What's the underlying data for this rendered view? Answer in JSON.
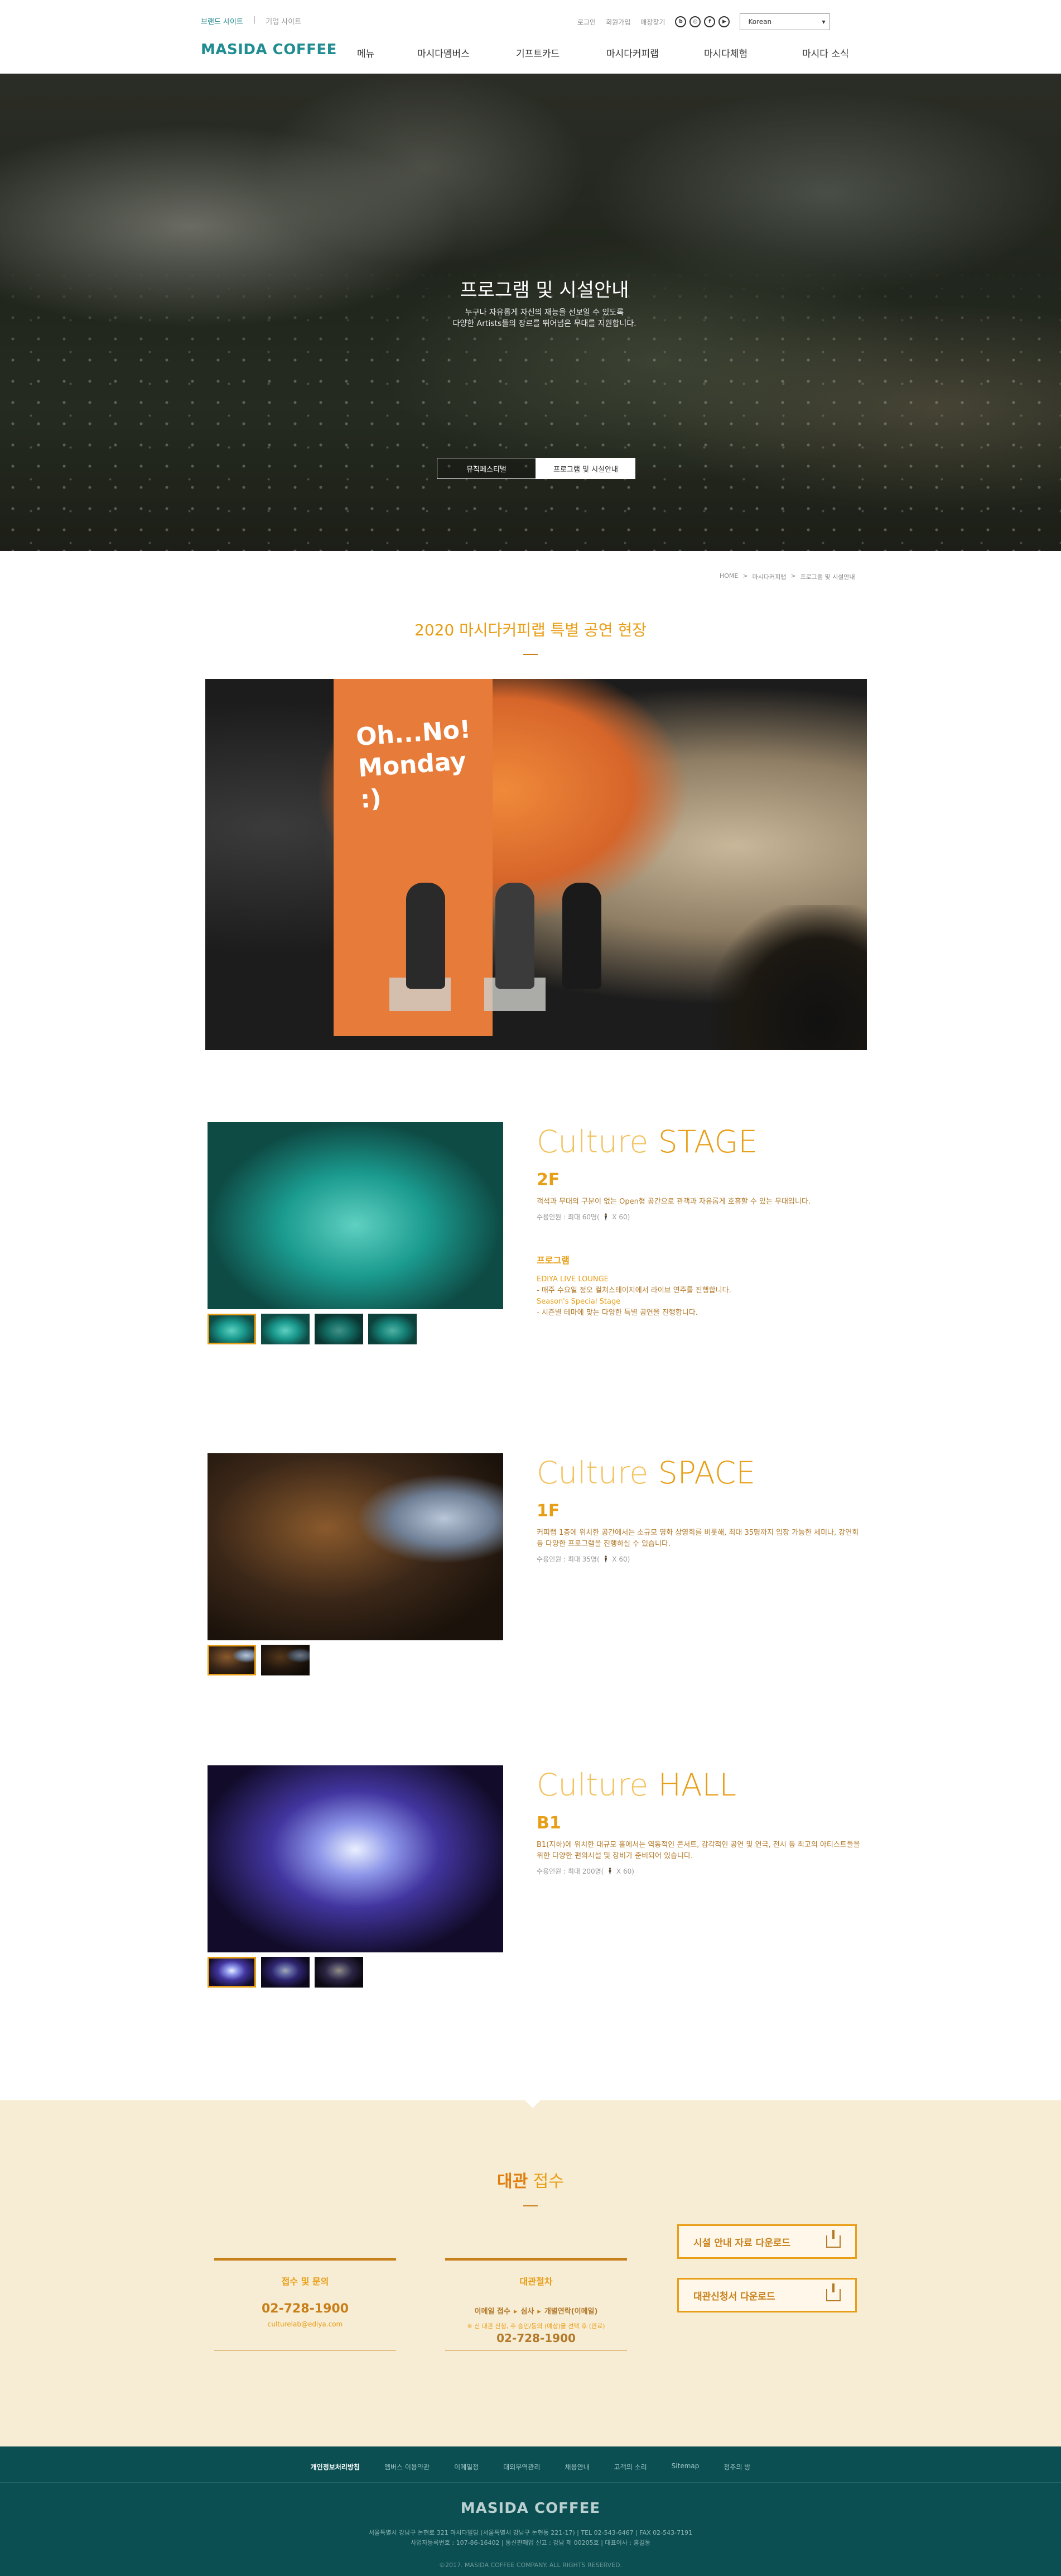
{
  "header": {
    "top_links": [
      "브랜드 사이트",
      "기업 사이트"
    ],
    "util_links": [
      "로그인",
      "회원가입",
      "매장찾기"
    ],
    "sns_icons": [
      "blog-icon",
      "instagram-icon",
      "facebook-icon",
      "youtube-icon"
    ],
    "language": "Korean",
    "logo": "MASIDA COFFEE",
    "menu": [
      "메뉴",
      "마시다멤버스",
      "기프트카드",
      "마시다커피랩",
      "마시다체험",
      "마시다 소식"
    ]
  },
  "hero": {
    "title": "프로그램 및 시설안내",
    "desc_line1": "누구나 자유롭게 자신의 재능을 선보일 수 있도록",
    "desc_line2": "다양한 Artists들의 장르를 뛰어넘은 무대를 지원합니다.",
    "tabs": [
      "뮤직페스티벌",
      "프로그램 및 시설안내"
    ],
    "active_tab": 1
  },
  "breadcrumb": [
    "HOME",
    ">",
    "마시다커피랩",
    ">",
    "프로그램 및 시설안내"
  ],
  "section_title": "2020 마시다커피랩 특별 공연 현장",
  "event_banner_text": "Oh...No!\nMonday\n:)",
  "venues": [
    {
      "culture": "Culture",
      "name": "STAGE",
      "floor": "2F",
      "desc": "객석과 무대의 구분이 없는 Open형 공간으로 관객과 자유롭게 호흡할 수 있는 무대입니다.",
      "capacity": "수용인원 : 최대 60명( 🕴 X 60)",
      "program_heading": "프로그램",
      "programs": [
        {
          "name": "EDIYA LIVE LOUNGE",
          "desc": "- 매주 수요일 정오 컬쳐스테이지에서 라이브 연주를 진행합니다."
        },
        {
          "name": "Season's Special Stage",
          "desc": "- 시즌별 테마에 맞는 다양한 특별 공연을 진행합니다."
        }
      ],
      "thumb_count": 4
    },
    {
      "culture": "Culture",
      "name": "SPACE",
      "floor": "1F",
      "desc": "커피랩 1층에 위치한 공간에서는 소규모 영화 상영회를 비롯해, 최대 35명까지 입장 가능한 세미나, 강연회 등 다양한 프로그램을 진행하실 수 있습니다.",
      "capacity": "수용인원 : 최대 35명( 🕴 X 60)",
      "thumb_count": 2
    },
    {
      "culture": "Culture",
      "name": "HALL",
      "floor": "B1",
      "desc": "B1(지하)에 위치한 대규모 홀에서는 역동적인 콘서트, 감각적인 공연 및 연극, 전시 등 최고의 아티스트들을 위한 다양한 편의시설 및 장비가 준비되어 있습니다.",
      "capacity": "수용인원 : 최대 200명( 🕴 X 60)",
      "thumb_count": 3
    }
  ],
  "rental": {
    "title_bold": "대관",
    "title_rest": " 접수",
    "contact": {
      "heading": "접수 및 문의",
      "phone": "02-728-1900",
      "email": "culturelab@ediya.com"
    },
    "procedure": {
      "heading": "대관절차",
      "steps": [
        "이메일 접수",
        "심사",
        "개별연락(이메일)"
      ],
      "note": "※ 신 대관 신청, 추 승인/등의 (예상)을 선택 후 (만료)",
      "phone": "02-728-1900"
    },
    "downloads": [
      "시설 안내 자료 다운로드",
      "대관신청서 다운로드"
    ]
  },
  "footer": {
    "nav": [
      "개인정보처리방침",
      "멤버스 이용약관",
      "이메일정",
      "대외무역관리",
      "채용안내",
      "고객의 소리",
      "Sitemap",
      "정주의 방"
    ],
    "logo": "MASIDA COFFEE",
    "address_line1": "서울특별시 강남구 논현로 321 마시다빌딩 (서울특별시 강남구 논현동 221-17)   |   TEL 02-543-6467   |   FAX 02-543-7191",
    "address_line2": "사업자등록번호 : 107-86-16402   |   통신판매업 신고 : 강남 제 00205호   |   대표이사 : 홍길동",
    "copyright": "©2017. MASIDA COFFEE COMPANY. ALL RIGHTS RESERVED."
  }
}
